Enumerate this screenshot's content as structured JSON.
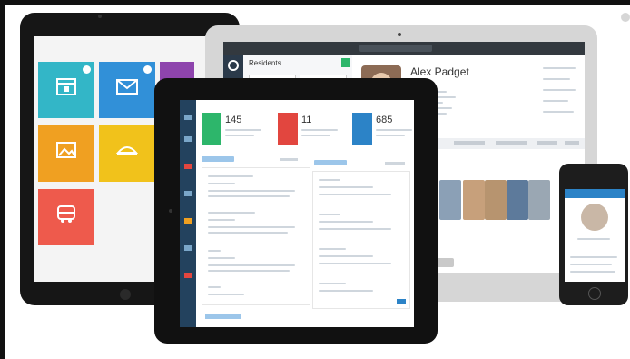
{
  "tablet_back": {
    "tiles": [
      {
        "label": "",
        "color": "#33b6c7"
      },
      {
        "label": "",
        "color": "#3190d8"
      },
      {
        "label": "",
        "color": "#f0a021"
      },
      {
        "label": "",
        "color": "#f1c21b"
      },
      {
        "label": "",
        "color": "#ee5a4c"
      }
    ]
  },
  "laptop": {
    "residents_title": "Residents",
    "profile_name": "Alex Padget"
  },
  "front_tablet": {
    "stat_1_value": "145",
    "stat_2_value": "11",
    "stat_3_value": "685"
  },
  "colors": {
    "accent_blue": "#2a7bc2",
    "sidebar_dark": "#23425e",
    "laptop_sidebar": "#2b3a4a",
    "green": "#2db66b",
    "red": "#e2463f"
  }
}
